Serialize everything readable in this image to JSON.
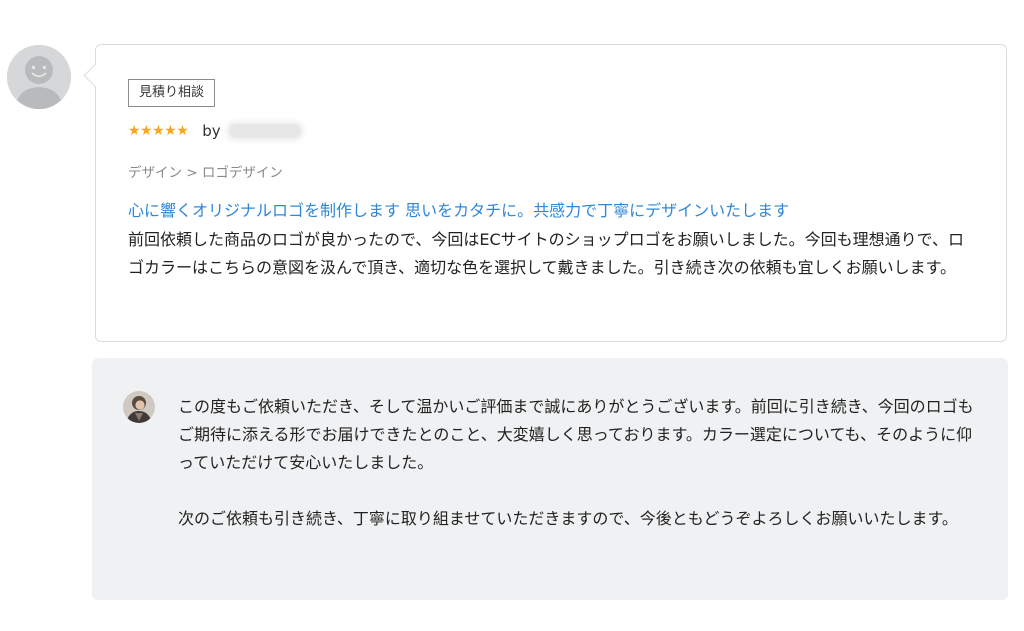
{
  "review": {
    "tag": "見積り相談",
    "stars": "★★★★★",
    "rating": 5,
    "by_label": "by",
    "breadcrumb": "デザイン > ロゴデザイン",
    "service_title": "心に響くオリジナルロゴを制作します 思いをカタチに。共感力で丁寧にデザインいたします",
    "text": "前回依頼した商品のロゴが良かったので、今回はECサイトのショップロゴをお願いしました。今回も理想通りで、ロゴカラーはこちらの意図を汲んで頂き、適切な色を選択して戴きました。引き続き次の依頼も宜しくお願いします。"
  },
  "reply": {
    "paragraph1": "この度もご依頼いただき、そして温かいご評価まで誠にありがとうございます。前回に引き続き、今回のロゴもご期待に添える形でお届けできたとのこと、大変嬉しく思っております。カラー選定についても、そのように仰っていただけて安心いたしました。",
    "paragraph2": "次のご依頼も引き続き、丁寧に取り組ませていただきますので、今後ともどうぞよろしくお願いいたします。"
  },
  "colors": {
    "star": "#f5a623",
    "link": "#2f87d8",
    "reply_bg": "#f0f1f2",
    "border": "#dcdcdc"
  },
  "icons": {
    "reviewer_avatar": "default-user-avatar-icon",
    "seller_avatar": "seller-photo-avatar"
  }
}
